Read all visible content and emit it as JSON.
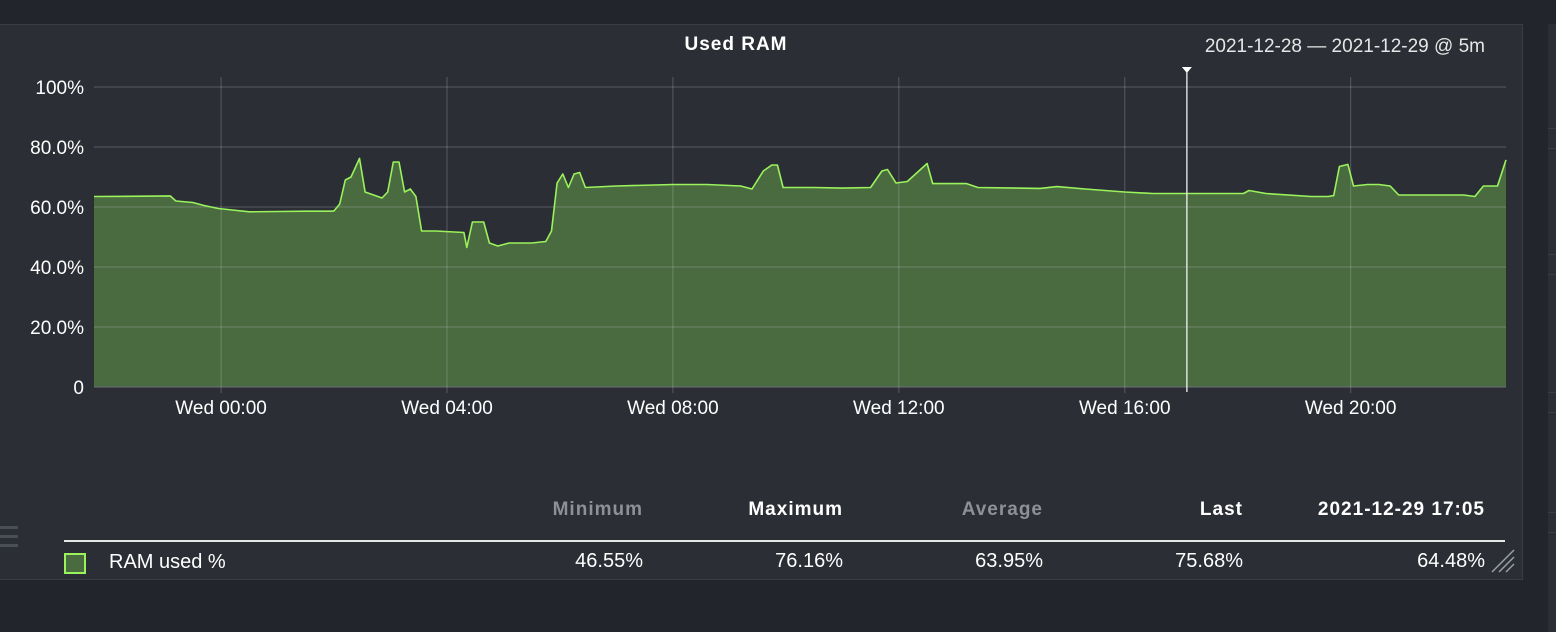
{
  "chart_data": {
    "type": "area",
    "title": "Used RAM",
    "range_label": "2021-12-28 — 2021-12-29 @ 5m",
    "y_ticks": [
      "100%",
      "80.0%",
      "60.0%",
      "40.0%",
      "20.0%",
      "0"
    ],
    "y_tick_values": [
      100,
      80,
      60,
      40,
      20,
      0
    ],
    "ylim": [
      0,
      100
    ],
    "x_ticks": [
      "Wed 00:00",
      "Wed 04:00",
      "Wed 08:00",
      "Wed 12:00",
      "Wed 16:00",
      "Wed 20:00"
    ],
    "x_tick_hours": [
      0,
      4,
      8,
      12,
      16,
      20
    ],
    "xlim_hours": [
      -2.25,
      22.75
    ],
    "cursor_hour": 17.1,
    "grid": true,
    "colors": {
      "line": "#9af25c",
      "fill": "#4a6b3f",
      "grid": "#4a4e57",
      "cursor": "#ffffff"
    },
    "series": [
      {
        "name": "RAM used %",
        "points": [
          [
            -2.25,
            63.5
          ],
          [
            -1.4,
            63.6
          ],
          [
            -0.9,
            63.7
          ],
          [
            -0.8,
            62.0
          ],
          [
            -0.5,
            61.5
          ],
          [
            -0.3,
            60.5
          ],
          [
            -0.05,
            59.5
          ],
          [
            0.2,
            59.0
          ],
          [
            0.5,
            58.4
          ],
          [
            1.0,
            58.5
          ],
          [
            1.5,
            58.6
          ],
          [
            1.95,
            58.6
          ],
          [
            2.0,
            58.7
          ],
          [
            2.1,
            61.0
          ],
          [
            2.2,
            69.0
          ],
          [
            2.3,
            70.0
          ],
          [
            2.45,
            76.2
          ],
          [
            2.55,
            65.0
          ],
          [
            2.7,
            64.0
          ],
          [
            2.85,
            63.0
          ],
          [
            2.95,
            65.0
          ],
          [
            3.05,
            75.0
          ],
          [
            3.15,
            75.0
          ],
          [
            3.25,
            65.0
          ],
          [
            3.35,
            66.0
          ],
          [
            3.45,
            63.5
          ],
          [
            3.55,
            52.0
          ],
          [
            3.8,
            52.0
          ],
          [
            4.3,
            51.5
          ],
          [
            4.35,
            46.5
          ],
          [
            4.45,
            55.0
          ],
          [
            4.65,
            55.0
          ],
          [
            4.75,
            48.0
          ],
          [
            4.9,
            47.0
          ],
          [
            5.1,
            48.0
          ],
          [
            5.5,
            48.0
          ],
          [
            5.75,
            48.5
          ],
          [
            5.85,
            52.0
          ],
          [
            5.95,
            68.0
          ],
          [
            6.05,
            71.0
          ],
          [
            6.15,
            66.5
          ],
          [
            6.25,
            71.0
          ],
          [
            6.35,
            71.5
          ],
          [
            6.45,
            66.5
          ],
          [
            7.0,
            67.0
          ],
          [
            8.0,
            67.5
          ],
          [
            8.6,
            67.5
          ],
          [
            9.2,
            67.0
          ],
          [
            9.4,
            66.0
          ],
          [
            9.6,
            72.0
          ],
          [
            9.75,
            74.0
          ],
          [
            9.85,
            74.0
          ],
          [
            9.95,
            66.5
          ],
          [
            10.5,
            66.5
          ],
          [
            11.0,
            66.3
          ],
          [
            11.5,
            66.5
          ],
          [
            11.7,
            72.0
          ],
          [
            11.8,
            72.5
          ],
          [
            11.95,
            68.0
          ],
          [
            12.15,
            68.5
          ],
          [
            12.5,
            74.5
          ],
          [
            12.6,
            67.8
          ],
          [
            13.2,
            67.8
          ],
          [
            13.4,
            66.5
          ],
          [
            14.5,
            66.2
          ],
          [
            14.8,
            66.8
          ],
          [
            15.3,
            66.0
          ],
          [
            16.0,
            65.0
          ],
          [
            16.5,
            64.5
          ],
          [
            17.3,
            64.5
          ],
          [
            18.1,
            64.5
          ],
          [
            18.2,
            65.5
          ],
          [
            18.5,
            64.5
          ],
          [
            19.3,
            63.5
          ],
          [
            19.6,
            63.5
          ],
          [
            19.7,
            63.8
          ],
          [
            19.8,
            73.5
          ],
          [
            19.95,
            74.2
          ],
          [
            20.05,
            67.0
          ],
          [
            20.3,
            67.5
          ],
          [
            20.5,
            67.5
          ],
          [
            20.7,
            67.0
          ],
          [
            20.85,
            64.0
          ],
          [
            21.2,
            64.0
          ],
          [
            22.0,
            64.0
          ],
          [
            22.2,
            63.5
          ],
          [
            22.35,
            67.0
          ],
          [
            22.6,
            67.0
          ],
          [
            22.75,
            75.7
          ]
        ]
      }
    ],
    "legend": {
      "headers": {
        "minimum": "Minimum",
        "maximum": "Maximum",
        "average": "Average",
        "last": "Last",
        "timestamp": "2021-12-29 17:05"
      },
      "row": {
        "name": "RAM used %",
        "minimum": "46.55%",
        "maximum": "76.16%",
        "average": "63.95%",
        "last": "75.68%",
        "at_cursor": "64.48%",
        "swatch_color": "#4a6b3f",
        "swatch_border": "#9af25c"
      }
    }
  }
}
